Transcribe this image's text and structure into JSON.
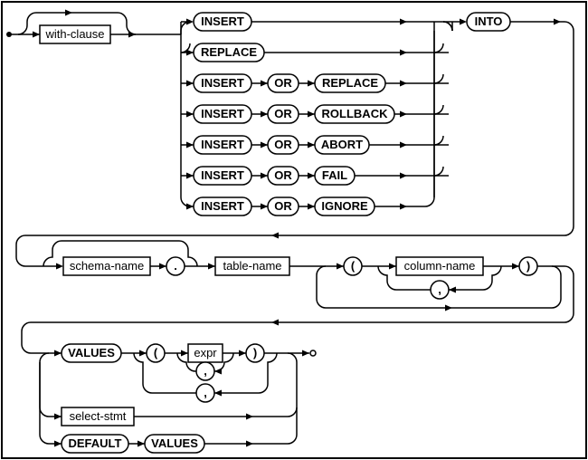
{
  "diagram_type": "railroad-syntax-diagram",
  "statement": "insert-stmt",
  "nodes": {
    "with_clause": "with-clause",
    "insert1": "INSERT",
    "replace1": "REPLACE",
    "insert2": "INSERT",
    "or2": "OR",
    "replace2": "REPLACE",
    "insert3": "INSERT",
    "or3": "OR",
    "rollback": "ROLLBACK",
    "insert4": "INSERT",
    "or4": "OR",
    "abort": "ABORT",
    "insert5": "INSERT",
    "or5": "OR",
    "fail": "FAIL",
    "insert6": "INSERT",
    "or6": "OR",
    "ignore": "IGNORE",
    "into": "INTO",
    "schema_name": "schema-name",
    "dot": ".",
    "table_name": "table-name",
    "lparen1": "(",
    "column_name": "column-name",
    "comma1": ",",
    "rparen1": ")",
    "values1": "VALUES",
    "lparen2": "(",
    "expr": "expr",
    "comma2": ",",
    "rparen2": ")",
    "comma3": ",",
    "select_stmt": "select-stmt",
    "default": "DEFAULT",
    "values2": "VALUES"
  }
}
